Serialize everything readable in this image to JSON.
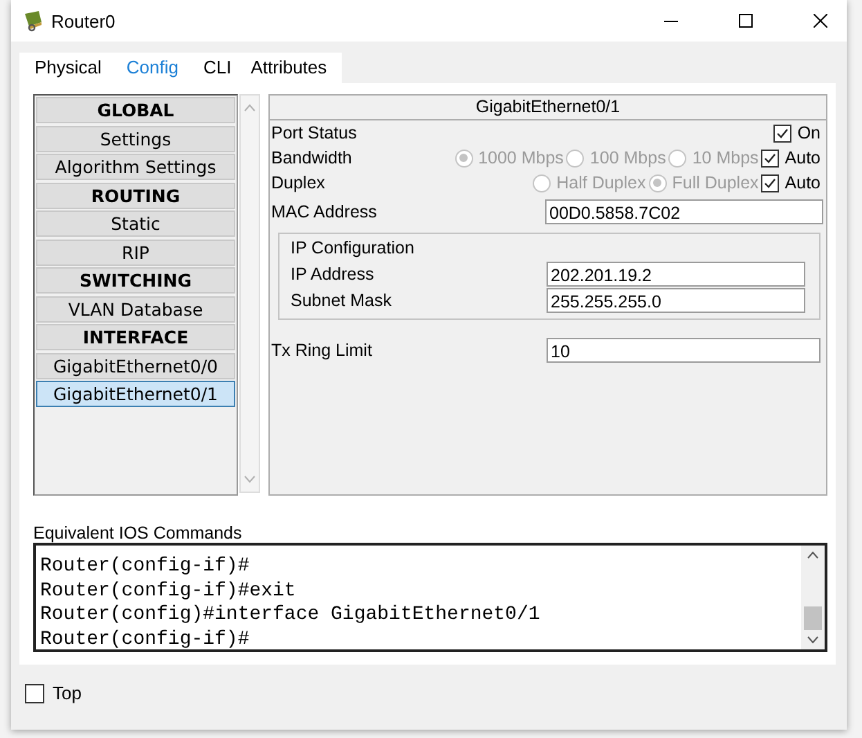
{
  "window": {
    "title": "Router0"
  },
  "tabs": [
    {
      "label": "Physical",
      "selected": false
    },
    {
      "label": "Config",
      "selected": true
    },
    {
      "label": "CLI",
      "selected": false
    },
    {
      "label": "Attributes",
      "selected": false
    }
  ],
  "sidebar": {
    "items": [
      {
        "label": "GLOBAL",
        "kind": "header",
        "selected": false
      },
      {
        "label": "Settings",
        "kind": "item",
        "selected": false
      },
      {
        "label": "Algorithm Settings",
        "kind": "item",
        "selected": false
      },
      {
        "label": "ROUTING",
        "kind": "header",
        "selected": false
      },
      {
        "label": "Static",
        "kind": "item",
        "selected": false
      },
      {
        "label": "RIP",
        "kind": "item",
        "selected": false
      },
      {
        "label": "SWITCHING",
        "kind": "header",
        "selected": false
      },
      {
        "label": "VLAN Database",
        "kind": "item",
        "selected": false
      },
      {
        "label": "INTERFACE",
        "kind": "header",
        "selected": false
      },
      {
        "label": "GigabitEthernet0/0",
        "kind": "item",
        "selected": false
      },
      {
        "label": "GigabitEthernet0/1",
        "kind": "item",
        "selected": true
      }
    ]
  },
  "interface": {
    "title": "GigabitEthernet0/1",
    "port_status": {
      "label": "Port Status",
      "toggle": {
        "label": "On",
        "checked": true
      }
    },
    "bandwidth": {
      "label": "Bandwidth",
      "disabled": true,
      "options": [
        {
          "label": "1000 Mbps",
          "selected": true
        },
        {
          "label": "100 Mbps",
          "selected": false
        },
        {
          "label": "10 Mbps",
          "selected": false
        }
      ],
      "auto": {
        "label": "Auto",
        "checked": true
      }
    },
    "duplex": {
      "label": "Duplex",
      "disabled": true,
      "options": [
        {
          "label": "Half Duplex",
          "selected": false
        },
        {
          "label": "Full Duplex",
          "selected": true
        }
      ],
      "auto": {
        "label": "Auto",
        "checked": true
      }
    },
    "mac_address": {
      "label": "MAC Address",
      "value": "00D0.5858.7C02"
    },
    "ip_configuration": {
      "title": "IP Configuration",
      "fields": [
        {
          "label": "IP Address",
          "value": "202.201.19.2"
        },
        {
          "label": "Subnet Mask",
          "value": "255.255.255.0"
        }
      ]
    },
    "tx_ring_limit": {
      "label": "Tx Ring Limit",
      "value": "10"
    }
  },
  "console": {
    "label": "Equivalent IOS Commands",
    "lines": [
      "Router(config-if)#",
      "Router(config-if)#exit",
      "Router(config)#interface GigabitEthernet0/1",
      "Router(config-if)#"
    ]
  },
  "top": {
    "label": "Top",
    "checked": false
  }
}
